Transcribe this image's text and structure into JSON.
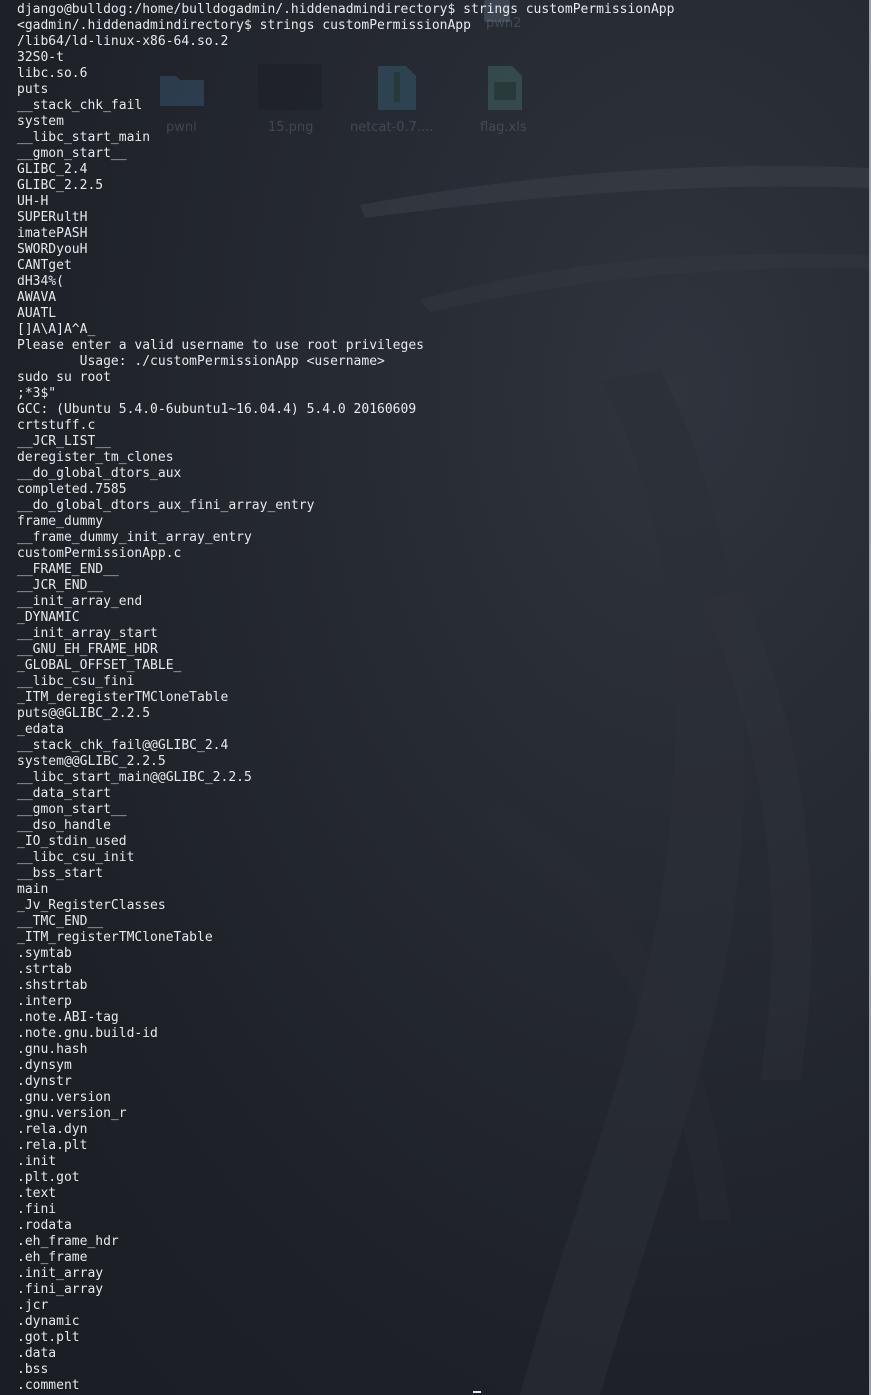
{
  "terminal": {
    "lines": [
      "django@bulldog:/home/bulldogadmin/.hiddenadmindirectory$ strings customPermissionApp",
      "<gadmin/.hiddenadmindirectory$ strings customPermissionApp",
      "/lib64/ld-linux-x86-64.so.2",
      "32S0-t",
      "libc.so.6",
      "puts",
      "__stack_chk_fail",
      "system",
      "__libc_start_main",
      "__gmon_start__",
      "GLIBC_2.4",
      "GLIBC_2.2.5",
      "UH-H",
      "SUPERultH",
      "imatePASH",
      "SWORDyouH",
      "CANTget",
      "dH34%(",
      "AWAVA",
      "AUATL",
      "[]A\\A]A^A_",
      "Please enter a valid username to use root privileges",
      "        Usage: ./customPermissionApp <username>",
      "sudo su root",
      ";*3$\"",
      "GCC: (Ubuntu 5.4.0-6ubuntu1~16.04.4) 5.4.0 20160609",
      "crtstuff.c",
      "__JCR_LIST__",
      "deregister_tm_clones",
      "__do_global_dtors_aux",
      "completed.7585",
      "__do_global_dtors_aux_fini_array_entry",
      "frame_dummy",
      "__frame_dummy_init_array_entry",
      "customPermissionApp.c",
      "__FRAME_END__",
      "__JCR_END__",
      "__init_array_end",
      "_DYNAMIC",
      "__init_array_start",
      "__GNU_EH_FRAME_HDR",
      "_GLOBAL_OFFSET_TABLE_",
      "__libc_csu_fini",
      "_ITM_deregisterTMCloneTable",
      "puts@@GLIBC_2.2.5",
      "_edata",
      "__stack_chk_fail@@GLIBC_2.4",
      "system@@GLIBC_2.2.5",
      "__libc_start_main@@GLIBC_2.2.5",
      "__data_start",
      "__gmon_start__",
      "__dso_handle",
      "_IO_stdin_used",
      "__libc_csu_init",
      "__bss_start",
      "main",
      "_Jv_RegisterClasses",
      "__TMC_END__",
      "_ITM_registerTMCloneTable",
      ".symtab",
      ".strtab",
      ".shstrtab",
      ".interp",
      ".note.ABI-tag",
      ".note.gnu.build-id",
      ".gnu.hash",
      ".dynsym",
      ".dynstr",
      ".gnu.version",
      ".gnu.version_r",
      ".rela.dyn",
      ".rela.plt",
      ".init",
      ".plt.got",
      ".text",
      ".fini",
      ".rodata",
      ".eh_frame_hdr",
      ".eh_frame",
      ".init_array",
      ".fini_array",
      ".jcr",
      ".dynamic",
      ".got.plt",
      ".data",
      ".bss",
      ".comment"
    ]
  },
  "desktop": {
    "icons": [
      {
        "label": "pwn2",
        "icon": "document-icon"
      },
      {
        "label": "pwnl",
        "icon": "folder-icon"
      },
      {
        "label": "15.png",
        "icon": "image-icon"
      },
      {
        "label": "netcat-0.7....",
        "icon": "archive-icon"
      },
      {
        "label": "flag.xls",
        "icon": "spreadsheet-icon"
      }
    ]
  }
}
